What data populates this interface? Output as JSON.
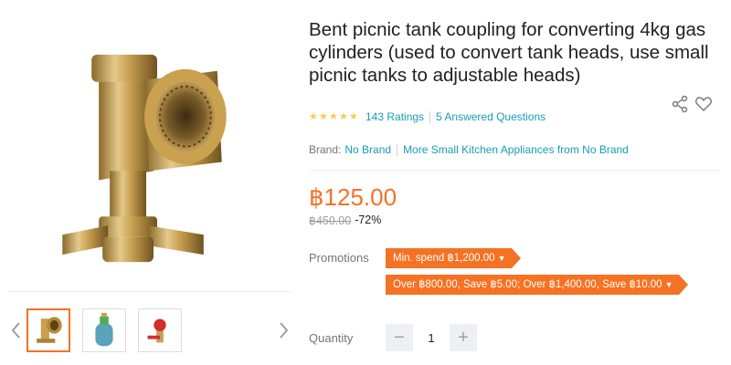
{
  "product": {
    "title": "Bent picnic tank coupling for converting 4kg gas cylinders (used to convert tank heads, use small picnic tanks to adjustable heads)",
    "ratings_count": "143 Ratings",
    "answered_questions": "5 Answered Questions",
    "star_rating": 4.5,
    "brand_label": "Brand:",
    "brand_name": "No Brand",
    "more_from_brand": "More Small Kitchen Appliances from No Brand",
    "price": "฿125.00",
    "original_price": "฿450.00",
    "discount": "-72%"
  },
  "promotions": {
    "label": "Promotions",
    "tags": [
      "Min. spend ฿1,200.00",
      "Over ฿800.00, Save ฿5.00; Over ฿1,400.00, Save ฿10.00"
    ]
  },
  "quantity": {
    "label": "Quantity",
    "value": "1",
    "minus": "−",
    "plus": "+"
  },
  "gallery": {
    "active_index": 0,
    "thumbnails": [
      "brass-elbow-fitting",
      "gas-tank-with-regulator",
      "red-gas-regulator"
    ]
  },
  "icons": {
    "share": "share-icon",
    "wishlist": "heart-icon",
    "prev": "chevron-left-icon",
    "next": "chevron-right-icon"
  },
  "colors": {
    "accent": "#f57224",
    "link": "#1a9cb7",
    "star": "#faca51"
  }
}
